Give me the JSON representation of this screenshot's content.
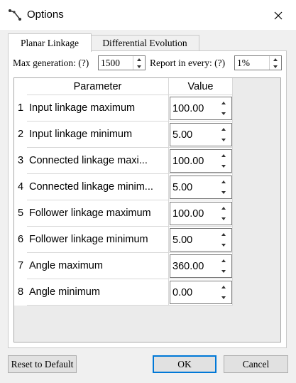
{
  "window": {
    "title": "Options",
    "icon": "linkage-icon",
    "close_icon": "close-icon"
  },
  "tabs": [
    {
      "label": "Planar Linkage",
      "active": true
    },
    {
      "label": "Differential Evolution",
      "active": false
    }
  ],
  "settings": {
    "max_generation_label": "Max generation: (?)",
    "max_generation_value": "1500",
    "report_label": "Report in every: (?)",
    "report_value": "1%"
  },
  "table": {
    "headers": {
      "parameter": "Parameter",
      "value": "Value"
    },
    "rows": [
      {
        "index": "1",
        "parameter": "Input linkage maximum",
        "value": "100.00"
      },
      {
        "index": "2",
        "parameter": "Input linkage minimum",
        "value": "5.00"
      },
      {
        "index": "3",
        "parameter": "Connected linkage maxi...",
        "value": "100.00"
      },
      {
        "index": "4",
        "parameter": "Connected linkage minim...",
        "value": "5.00"
      },
      {
        "index": "5",
        "parameter": "Follower linkage maximum",
        "value": "100.00"
      },
      {
        "index": "6",
        "parameter": "Follower linkage minimum",
        "value": "5.00"
      },
      {
        "index": "7",
        "parameter": "Angle maximum",
        "value": "360.00"
      },
      {
        "index": "8",
        "parameter": "Angle minimum",
        "value": "0.00"
      }
    ]
  },
  "buttons": {
    "reset": "Reset to Default",
    "ok": "OK",
    "cancel": "Cancel"
  },
  "colors": {
    "default_button_border": "#0078d7",
    "dialog_bg": "#f0f0f0"
  }
}
